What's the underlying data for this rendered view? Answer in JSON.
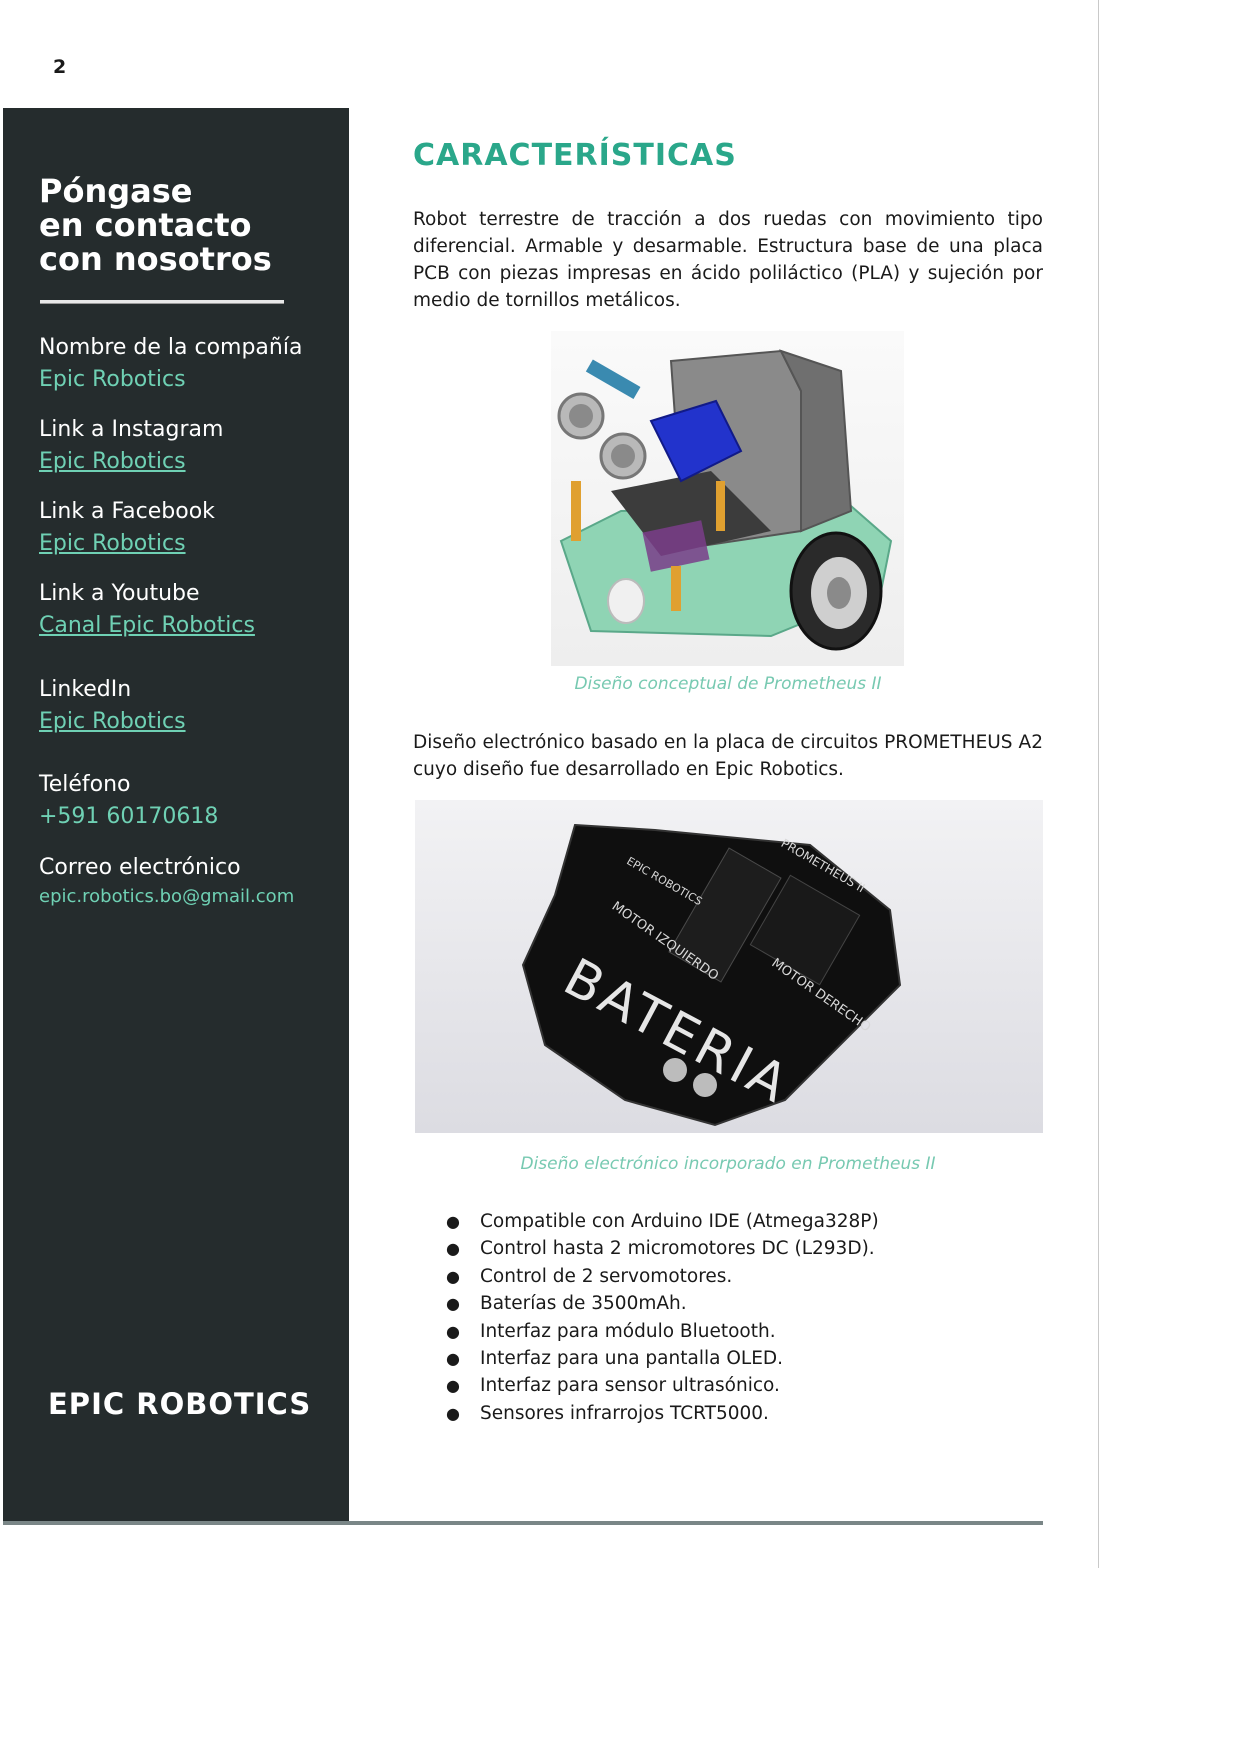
{
  "page_number": "2",
  "sidebar": {
    "title": "Póngase\nen contacto\ncon nosotros",
    "contacts": [
      {
        "label": "Nombre de la compañía",
        "value": "Epic Robotics"
      },
      {
        "label": "Link a Instagram",
        "value": "Epic Robotics"
      },
      {
        "label": "Link a Facebook",
        "value": "Epic Robotics"
      },
      {
        "label": "Link a Youtube",
        "value": "Canal Epic Robotics"
      },
      {
        "label": "LinkedIn",
        "value": "Epic Robotics"
      },
      {
        "label": "Teléfono",
        "value": "+591 60170618"
      },
      {
        "label": "Correo electrónico",
        "value": "epic.robotics.bo@gmail.com"
      }
    ],
    "brand": "EPIC ROBOTICS"
  },
  "main": {
    "title": "CARACTERÍSTICAS",
    "intro": "Robot terrestre de tracción a dos ruedas con movimiento tipo diferencial. Armable y desarmable. Estructura base de una placa PCB con piezas impresas en ácido poliláctico (PLA) y sujeción por medio de tornillos metálicos.",
    "figure1_caption": "Diseño conceptual de Prometheus II",
    "electronics_text": "Diseño electrónico basado en la placa de circuitos PROMETHEUS A2 cuyo diseño fue desarrollado en Epic Robotics.",
    "figure2_caption": "Diseño electrónico incorporado en Prometheus II",
    "pcb_labels": {
      "logo": "EPIC ROBOTICS",
      "board": "PROMETHEUS II",
      "motor_left": "MOTOR IZQUIERDO",
      "motor_right": "MOTOR DERECHO",
      "battery": "BATERIA"
    },
    "features": [
      "Compatible con Arduino IDE (Atmega328P)",
      "Control hasta 2 micromotores DC (L293D).",
      "Control de 2 servomotores.",
      "Baterías de 3500mAh.",
      "Interfaz para módulo Bluetooth.",
      "Interfaz para una pantalla OLED.",
      "Interfaz para sensor ultrasónico.",
      "Sensores infrarrojos TCRT5000."
    ]
  },
  "colors": {
    "sidebar_bg": "#252c2d",
    "accent_title": "#2aa78a",
    "accent_link": "#6fd1b4",
    "caption": "#77c9b1"
  }
}
